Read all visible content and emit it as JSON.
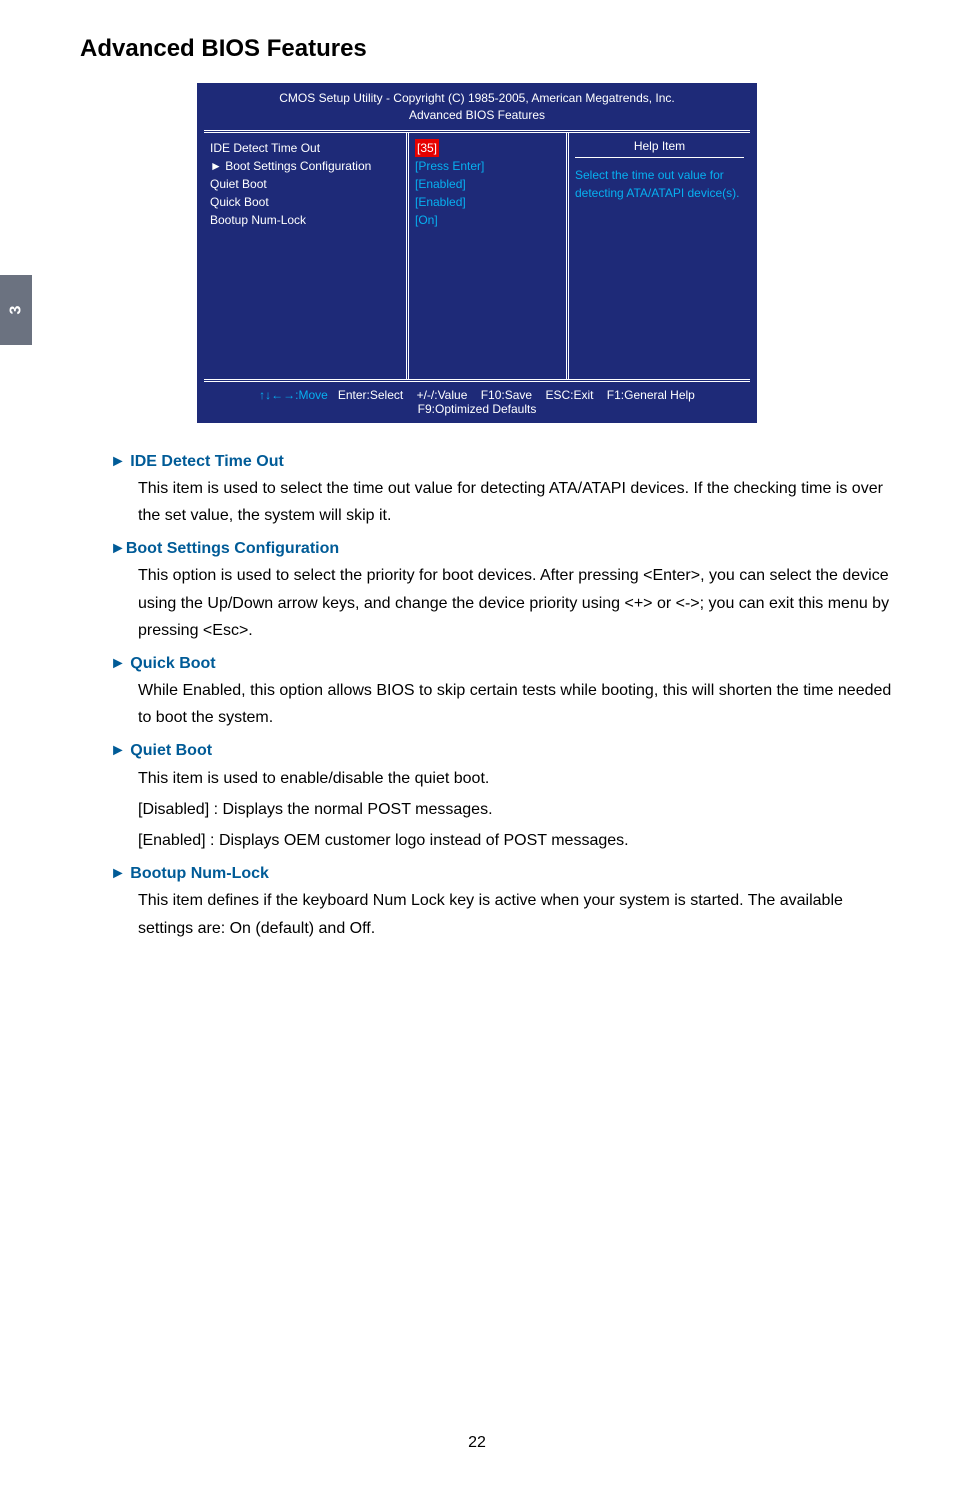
{
  "page": {
    "title": "Advanced BIOS Features",
    "number": "22",
    "sidetab": "3"
  },
  "bios": {
    "header1": "CMOS Setup Utility - Copyright (C) 1985-2005, American Megatrends, Inc.",
    "header2": "Advanced BIOS Features",
    "rows": {
      "r1_label": "IDE Detect Time Out",
      "r1_value": "[35]",
      "r2_label": "► Boot Settings Configuration",
      "r2_value": "[Press Enter]",
      "r3_label": "Quiet Boot",
      "r3_value": "[Enabled]",
      "r4_label": "Quick Boot",
      "r4_value": "[Enabled]",
      "r5_label": "Bootup Num-Lock",
      "r5_value": "[On]"
    },
    "help": {
      "title": "Help Item",
      "body": "Select the time out value for detecting ATA/ATAPI device(s)."
    },
    "footer": {
      "move": "↑↓←→:Move",
      "enter": "Enter:Select",
      "value": "+/-/:Value",
      "save": "F10:Save",
      "exit": "ESC:Exit",
      "help": "F1:General Help",
      "defaults": "F9:Optimized Defaults"
    }
  },
  "content": {
    "s1_title": "► IDE Detect Time Out",
    "s1_body": "This item is used to select the time out value for detecting ATA/ATAPI devices. If the checking time is over the set value, the system will skip it.",
    "s2_title": "►Boot Settings Configuration",
    "s2_body": "This option is used to select the priority for boot devices. After pressing <Enter>, you can select the device using the Up/Down arrow keys, and change the device priority using <+> or <->; you can exit this menu by pressing <Esc>.",
    "s3_title": "► Quick Boot",
    "s3_body": "While Enabled, this option allows BIOS to skip certain tests while booting, this will shorten the time needed to boot the system.",
    "s4_title": "► Quiet Boot",
    "s4_body1": "This item is used to enable/disable the quiet boot.",
    "s4_body2": "[Disabled] : Displays the normal POST messages.",
    "s4_body3": "[Enabled] : Displays OEM customer logo instead of POST messages.",
    "s5_title": "► Bootup Num-Lock",
    "s5_body": "This item defines if the keyboard Num Lock key is active when your system is started. The available settings are: On (default) and Off."
  }
}
